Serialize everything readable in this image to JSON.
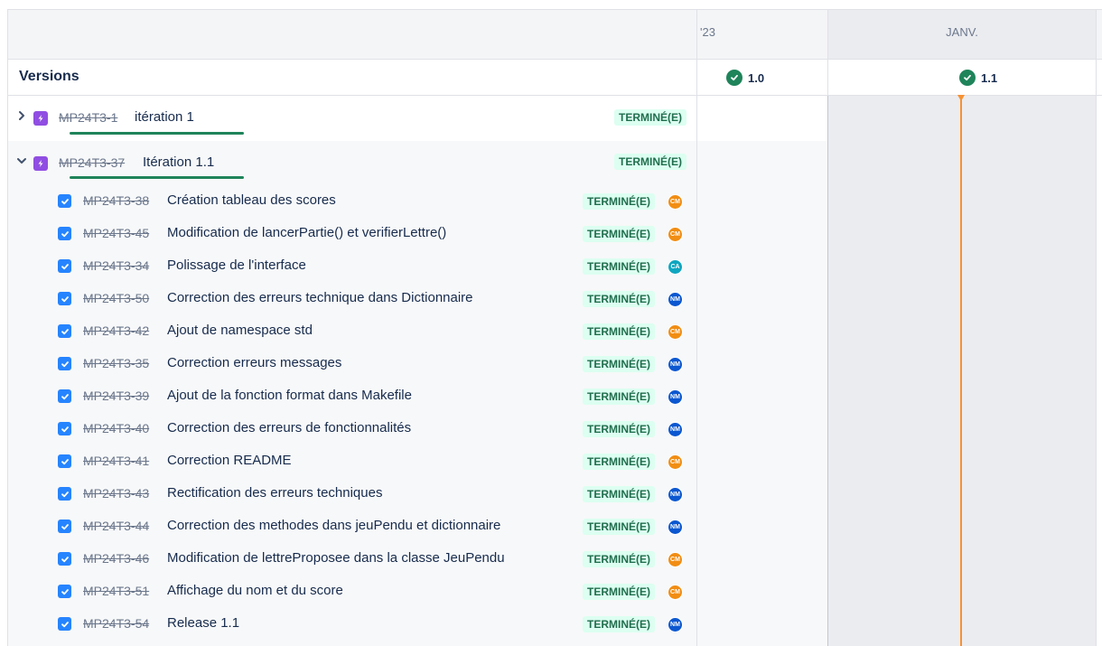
{
  "header": {
    "year_label": "'23",
    "month_label": "JANV."
  },
  "versions": {
    "label": "Versions",
    "items": [
      {
        "name": "1.0",
        "icon": "check-circle-icon"
      },
      {
        "name": "1.1",
        "icon": "check-circle-icon"
      }
    ]
  },
  "colors": {
    "status_bg": "#dcfff1",
    "status_text": "#216e4e",
    "epic_purple": "#904ee2",
    "checkbox_blue": "#2684ff",
    "today_marker": "#f79233",
    "progress_green": "#1f845a",
    "avatar_cm": "#f18d13",
    "avatar_ca": "#0fa6c0",
    "avatar_nm": "#0b57d0"
  },
  "epics": [
    {
      "key": "MP24T3-1",
      "title": "itération 1",
      "status": "TERMINÉ(E)",
      "expanded": false,
      "progress_percent": 100
    },
    {
      "key": "MP24T3-37",
      "title": "Itération 1.1",
      "status": "TERMINÉ(E)",
      "expanded": true,
      "progress_percent": 100
    }
  ],
  "tasks": [
    {
      "key": "MP24T3-38",
      "title": "Création tableau des scores",
      "status": "TERMINÉ(E)",
      "assignee": "CM"
    },
    {
      "key": "MP24T3-45",
      "title": "Modification de lancerPartie() et verifierLettre()",
      "status": "TERMINÉ(E)",
      "assignee": "CM"
    },
    {
      "key": "MP24T3-34",
      "title": "Polissage de l'interface",
      "status": "TERMINÉ(E)",
      "assignee": "CA"
    },
    {
      "key": "MP24T3-50",
      "title": "Correction des erreurs technique dans Dictionnaire",
      "status": "TERMINÉ(E)",
      "assignee": "NM"
    },
    {
      "key": "MP24T3-42",
      "title": "Ajout de namespace std",
      "status": "TERMINÉ(E)",
      "assignee": "CM"
    },
    {
      "key": "MP24T3-35",
      "title": "Correction erreurs messages",
      "status": "TERMINÉ(E)",
      "assignee": "NM"
    },
    {
      "key": "MP24T3-39",
      "title": "Ajout de la fonction format dans Makefile",
      "status": "TERMINÉ(E)",
      "assignee": "NM"
    },
    {
      "key": "MP24T3-40",
      "title": "Correction des erreurs de fonctionnalités",
      "status": "TERMINÉ(E)",
      "assignee": "NM"
    },
    {
      "key": "MP24T3-41",
      "title": "Correction README",
      "status": "TERMINÉ(E)",
      "assignee": "CM"
    },
    {
      "key": "MP24T3-43",
      "title": "Rectification des erreurs techniques",
      "status": "TERMINÉ(E)",
      "assignee": "NM"
    },
    {
      "key": "MP24T3-44",
      "title": "Correction des methodes dans jeuPendu et dictionnaire",
      "status": "TERMINÉ(E)",
      "assignee": "NM"
    },
    {
      "key": "MP24T3-46",
      "title": "Modification de lettreProposee dans la classe JeuPendu",
      "status": "TERMINÉ(E)",
      "assignee": "CM"
    },
    {
      "key": "MP24T3-51",
      "title": "Affichage du nom et du score",
      "status": "TERMINÉ(E)",
      "assignee": "CM"
    },
    {
      "key": "MP24T3-54",
      "title": "Release 1.1",
      "status": "TERMINÉ(E)",
      "assignee": "NM"
    }
  ]
}
